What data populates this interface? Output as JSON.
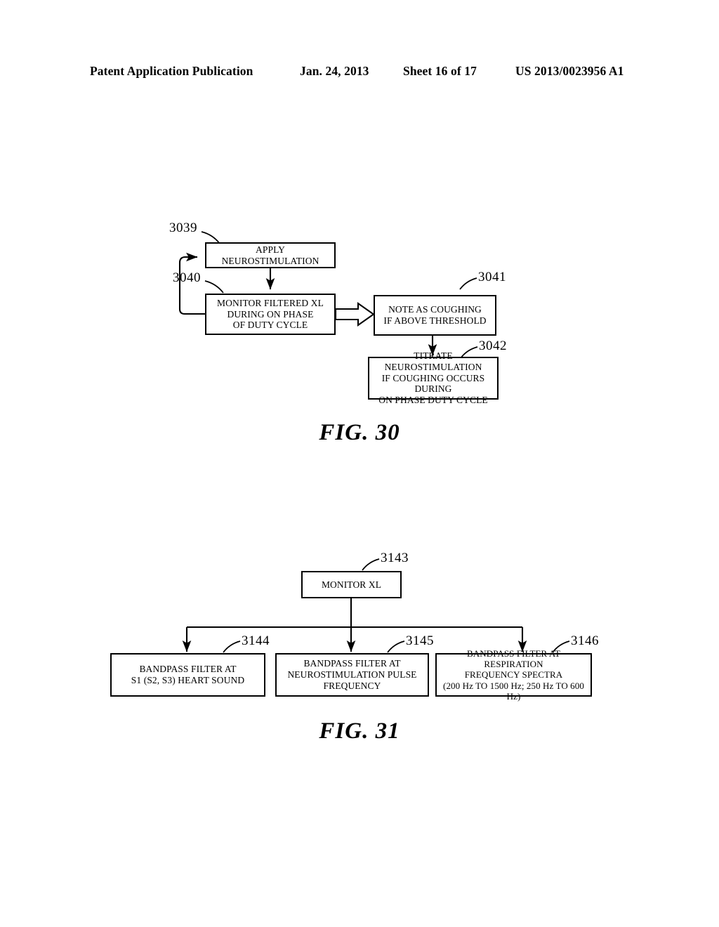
{
  "header": {
    "publication": "Patent Application Publication",
    "date": "Jan. 24, 2013",
    "sheet": "Sheet 16 of 17",
    "doc_number": "US 2013/0023956 A1"
  },
  "figures": [
    {
      "caption": "FIG. 30",
      "boxes": [
        {
          "ref": "3039",
          "text": "APPLY NEUROSTIMULATION"
        },
        {
          "ref": "3040",
          "text": "MONITOR FILTERED XL\nDURING ON PHASE\nOF DUTY CYCLE"
        },
        {
          "ref": "3041",
          "text": "NOTE AS COUGHING\nIF ABOVE THRESHOLD"
        },
        {
          "ref": "3042",
          "text": "TITRATE NEUROSTIMULATION\nIF COUGHING OCCURS DURING\nON PHASE DUTY CYCLE"
        }
      ]
    },
    {
      "caption": "FIG. 31",
      "boxes": [
        {
          "ref": "3143",
          "text": "MONITOR XL"
        },
        {
          "ref": "3144",
          "text": "BANDPASS FILTER AT\nS1 (S2, S3) HEART SOUND"
        },
        {
          "ref": "3145",
          "text": "BANDPASS FILTER AT\nNEUROSTIMULATION PULSE\nFREQUENCY"
        },
        {
          "ref": "3146",
          "text": "BANDPASS FILTER AT RESPIRATION\nFREQUENCY SPECTRA\n(200 Hz TO 1500 Hz; 250 Hz TO 600 Hz)"
        }
      ]
    }
  ],
  "colors": {
    "ink": "#000000",
    "paper": "#ffffff"
  }
}
